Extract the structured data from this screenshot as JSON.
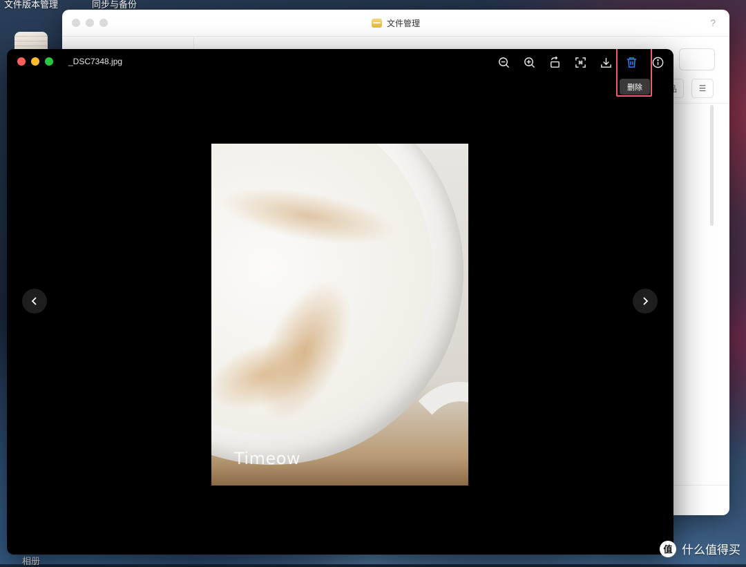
{
  "desktop": {
    "labels": [
      "文件版本管理",
      "同步与备份",
      "相册"
    ]
  },
  "file_manager": {
    "title": "文件管理",
    "help": "?",
    "toolbar": {
      "view_icon": "品",
      "sort_icon": "☰"
    }
  },
  "viewer": {
    "filename": "_DSC7348.jpg",
    "tools": [
      {
        "name": "zoom-out-icon"
      },
      {
        "name": "zoom-in-icon"
      },
      {
        "name": "rotate-icon"
      },
      {
        "name": "fit-icon"
      },
      {
        "name": "download-icon"
      },
      {
        "name": "delete-icon"
      },
      {
        "name": "info-icon"
      }
    ],
    "tooltip": "删除",
    "photo_watermark": "Timeow",
    "colors": {
      "delete_active": "#2f7cf6",
      "highlight_border": "#f05d6c"
    }
  },
  "brand": {
    "logo_text": "值",
    "name": "什么值得买"
  }
}
